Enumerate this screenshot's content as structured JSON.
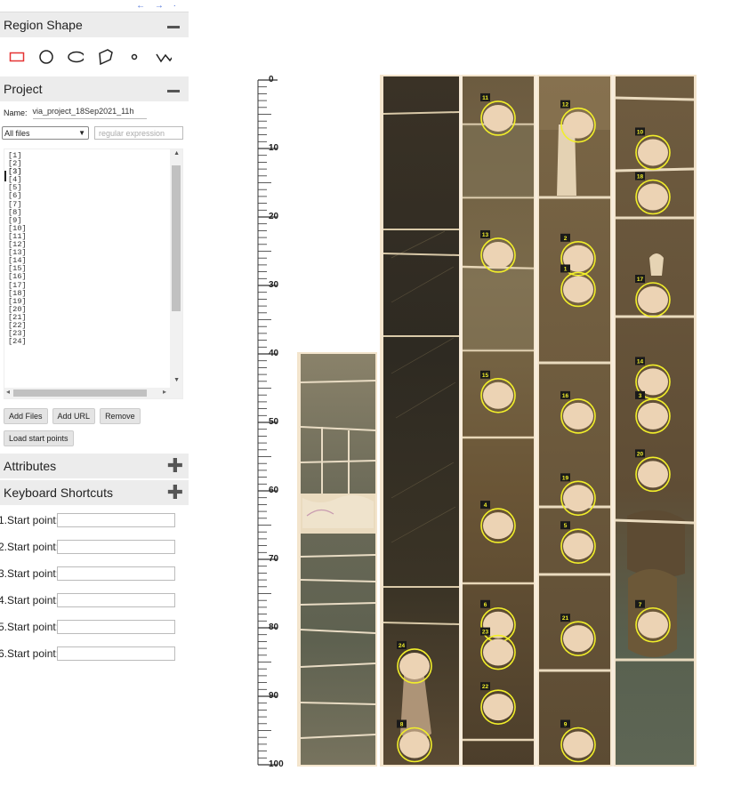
{
  "nav": {
    "arrows": "← → ·"
  },
  "region_shape": {
    "title": "Region Shape",
    "shapes": [
      "rectangle",
      "circle",
      "ellipse",
      "polygon",
      "point",
      "polyline"
    ]
  },
  "project": {
    "title": "Project",
    "name_label": "Name:",
    "name_value": "via_project_18Sep2021_11h",
    "filter_selected": "All files",
    "regex_placeholder": "regular expression",
    "files": [
      "[1]",
      "[2]",
      "[3]",
      "[4]",
      "[5]",
      "[6]",
      "[7]",
      "[8]",
      "[9]",
      "[10]",
      "[11]",
      "[12]",
      "[13]",
      "[14]",
      "[15]",
      "[16]",
      "[17]",
      "[18]",
      "[19]",
      "[20]",
      "[21]",
      "[22]",
      "[23]",
      "[24]"
    ],
    "buttons": {
      "add_files": "Add Files",
      "add_url": "Add URL",
      "remove": "Remove",
      "load_start": "Load start points"
    }
  },
  "attributes": {
    "title": "Attributes"
  },
  "keyboard": {
    "title": "Keyboard Shortcuts"
  },
  "start_points": [
    {
      "label": "1.Start point:",
      "value": ""
    },
    {
      "label": "2.Start point:",
      "value": ""
    },
    {
      "label": "3.Start point:",
      "value": ""
    },
    {
      "label": "4.Start point:",
      "value": ""
    },
    {
      "label": "5.Start point:",
      "value": ""
    },
    {
      "label": "6.Start point:",
      "value": ""
    }
  ],
  "scale": {
    "labels": [
      "0",
      "10",
      "20",
      "30",
      "40",
      "50",
      "60",
      "70",
      "80",
      "90",
      "100"
    ]
  },
  "regions": [
    {
      "id": "11",
      "col": 2,
      "depth": 3.5
    },
    {
      "id": "12",
      "col": 3,
      "depth": 4.5
    },
    {
      "id": "10",
      "col": 4,
      "depth": 8.5
    },
    {
      "id": "18",
      "col": 4,
      "depth": 15.0
    },
    {
      "id": "13",
      "col": 2,
      "depth": 23.5
    },
    {
      "id": "2",
      "col": 3,
      "depth": 24.0
    },
    {
      "id": "1",
      "col": 3,
      "depth": 28.5
    },
    {
      "id": "17",
      "col": 4,
      "depth": 30.0
    },
    {
      "id": "15",
      "col": 2,
      "depth": 44.0
    },
    {
      "id": "14",
      "col": 4,
      "depth": 42.0
    },
    {
      "id": "16",
      "col": 3,
      "depth": 47.0
    },
    {
      "id": "3",
      "col": 4,
      "depth": 47.0
    },
    {
      "id": "20",
      "col": 4,
      "depth": 55.5
    },
    {
      "id": "19",
      "col": 3,
      "depth": 59.0
    },
    {
      "id": "4",
      "col": 2,
      "depth": 63.0
    },
    {
      "id": "5",
      "col": 3,
      "depth": 66.0
    },
    {
      "id": "6",
      "col": 2,
      "depth": 77.5
    },
    {
      "id": "7",
      "col": 4,
      "depth": 77.5
    },
    {
      "id": "21",
      "col": 3,
      "depth": 79.5
    },
    {
      "id": "23",
      "col": 2,
      "depth": 81.5
    },
    {
      "id": "24",
      "col": 1,
      "depth": 83.5
    },
    {
      "id": "22",
      "col": 2,
      "depth": 89.5
    },
    {
      "id": "8",
      "col": 1,
      "depth": 95.0
    },
    {
      "id": "9",
      "col": 3,
      "depth": 95.0
    }
  ],
  "colors": {
    "region_stroke": "#f2ef2a",
    "panel_header": "#ececec",
    "active_shape": "#e53333"
  }
}
